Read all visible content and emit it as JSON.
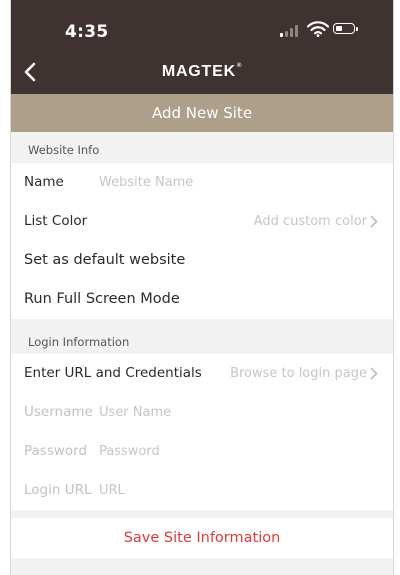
{
  "status_bar": {
    "time": "4:35"
  },
  "nav": {
    "brand": "MAGTEK",
    "brand_mark": "®",
    "title": "Add New Site"
  },
  "website_info": {
    "section_label": "Website Info",
    "name_label": "Name",
    "name_placeholder": "Website Name",
    "list_color_label": "List Color",
    "list_color_value": "Add custom color",
    "default_label": "Set as default website",
    "full_screen_label": "Run Full Screen Mode"
  },
  "login_info": {
    "section_label": "Login Information",
    "url_credentials_label": "Enter URL and Credentials",
    "browse_value": "Browse to login page",
    "username_label": "Username",
    "username_placeholder": "User Name",
    "password_label": "Password",
    "password_placeholder": "Password",
    "login_url_label": "Login URL",
    "login_url_placeholder": "URL"
  },
  "actions": {
    "save_label": "Save Site Information"
  },
  "colors": {
    "nav_bg": "#3e3331",
    "subheader_bg": "#ad9f89",
    "save_text": "#e53935"
  },
  "icons": {
    "back": "chevron-left-icon",
    "forward": "chevron-right-icon"
  }
}
